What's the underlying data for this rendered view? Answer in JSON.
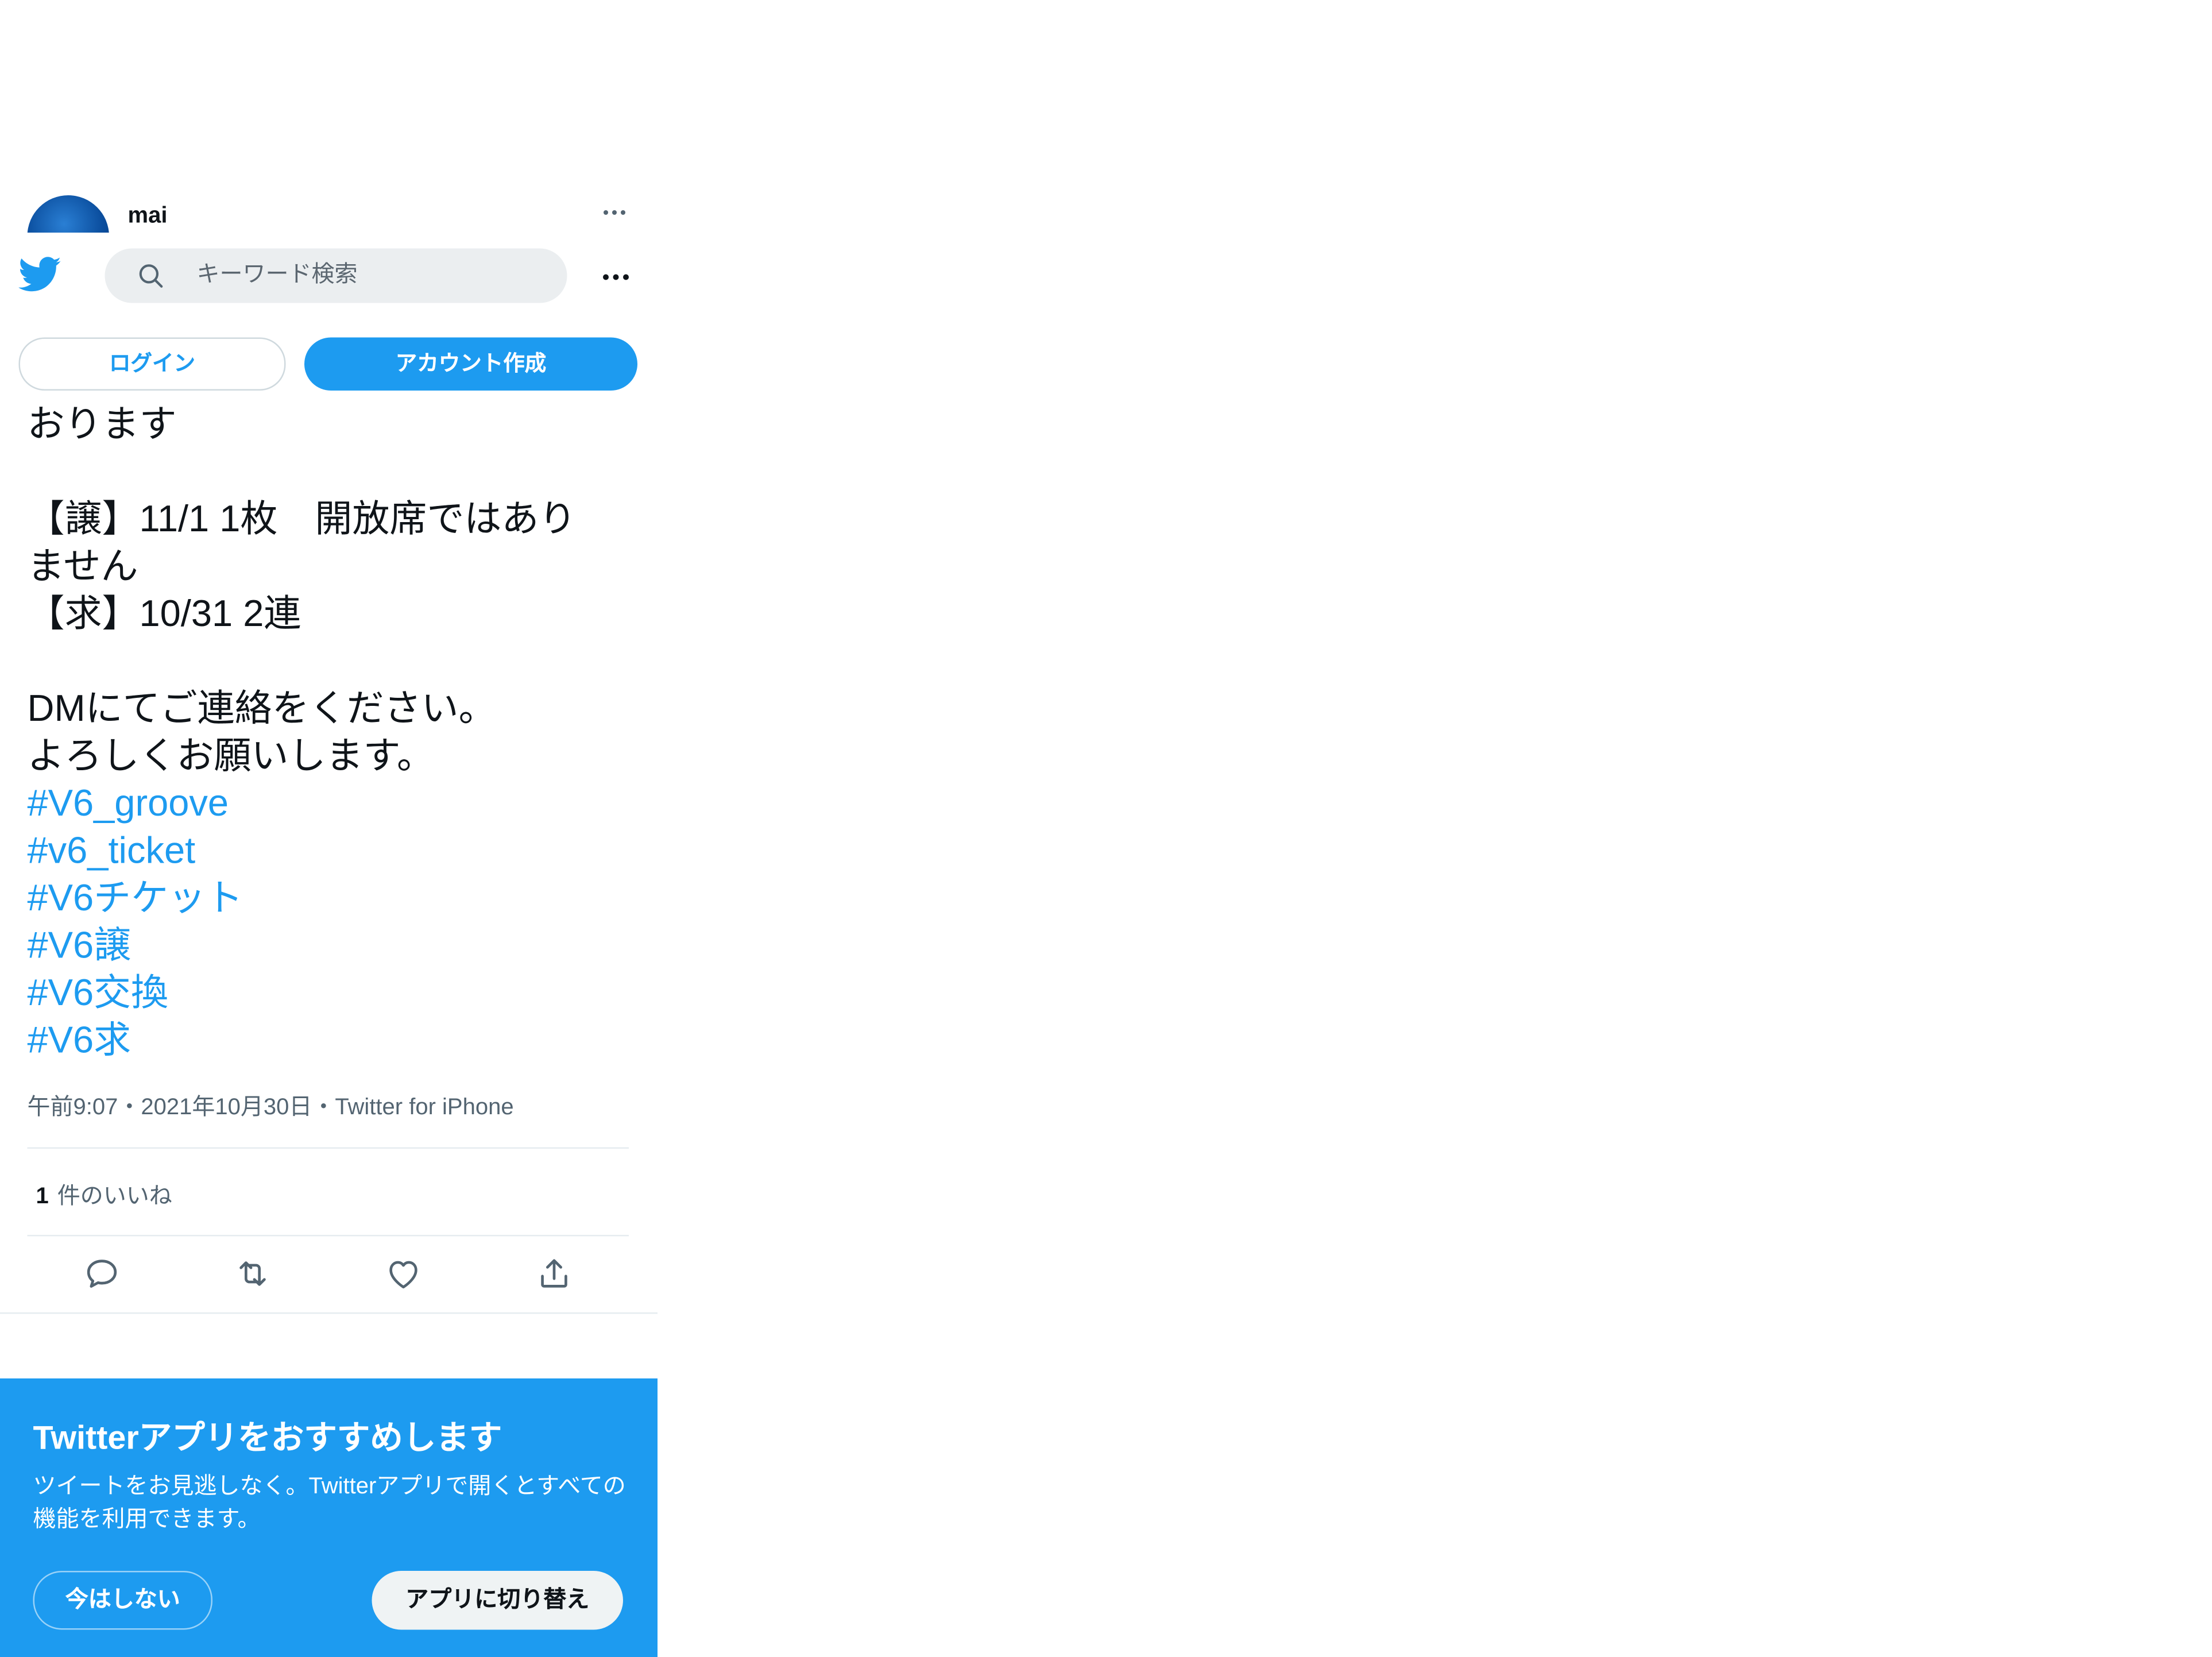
{
  "user": {
    "name": "mai"
  },
  "search": {
    "placeholder": "キーワード検索"
  },
  "auth": {
    "login_label": "ログイン",
    "signup_label": "アカウント作成"
  },
  "tweet": {
    "lines": [
      "おります",
      "",
      "【譲】11/1 1枚　開放席ではあり",
      "ません",
      "【求】10/31 2連",
      "",
      "DMにてご連絡をください。",
      "よろしくお願いします。"
    ],
    "hashtags": [
      "#V6_groove",
      "#v6_ticket",
      "#V6チケット",
      "#V6譲",
      "#V6交換",
      "#V6求"
    ],
    "meta": "午前9:07・2021年10月30日・Twitter for iPhone",
    "like_count": "1",
    "like_label": "件のいいね"
  },
  "actions": {
    "reply_icon": "reply-icon",
    "retweet_icon": "retweet-icon",
    "like_icon": "heart-icon",
    "share_icon": "share-icon"
  },
  "banner": {
    "title": "Twitterアプリをおすすめします",
    "description": "ツイートをお見逃しなく。Twitterアプリで開くとすべての機能を利用できます。",
    "later_label": "今はしない",
    "switch_label": "アプリに切り替え"
  },
  "colors": {
    "accent": "#1d9bf0",
    "text": "#0f1419",
    "secondary": "#536471",
    "divider": "#e6ecf0"
  }
}
